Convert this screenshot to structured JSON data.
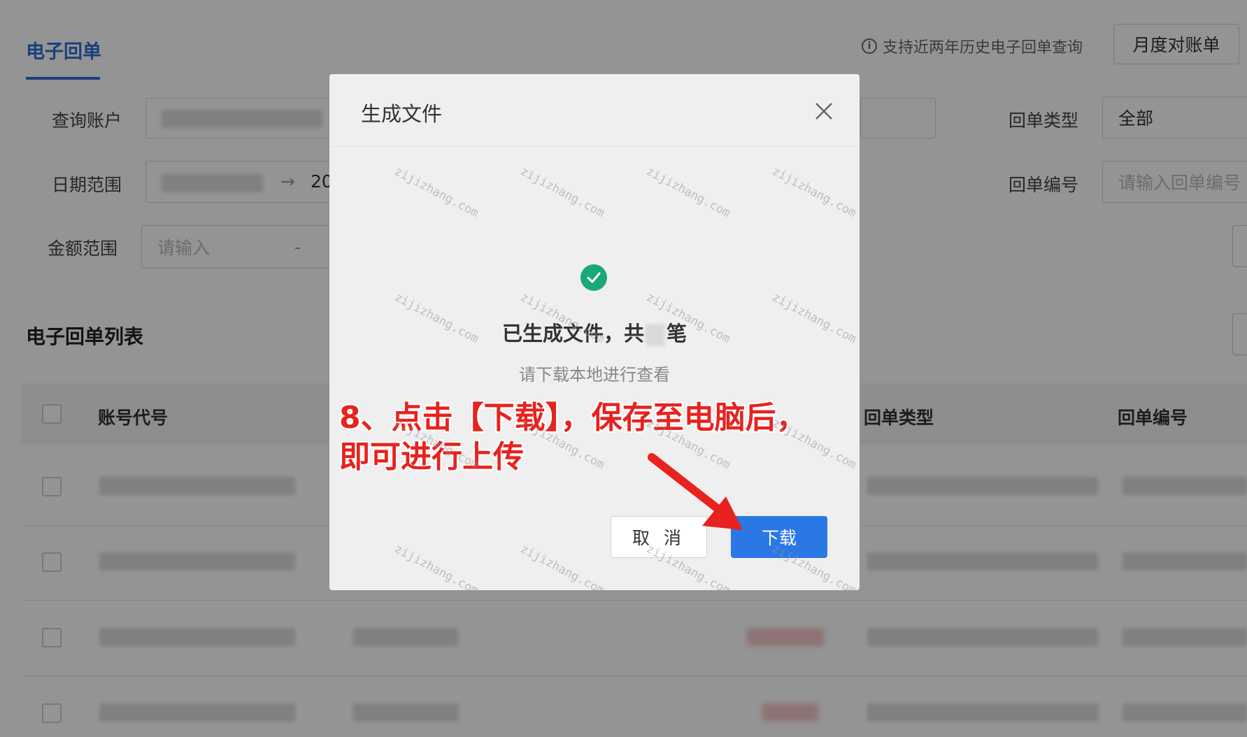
{
  "page": {
    "tab_label": "电子回单",
    "notice_text": "支持近两年历史电子回单查询",
    "monthly_button": "月度对账单",
    "filters": {
      "account_label": "查询账户",
      "date_label": "日期范围",
      "date_separator": "→",
      "date_end_prefix": "20",
      "amount_label": "金额范围",
      "amount_placeholder": "请输入",
      "amount_separator": "-",
      "type_label": "回单类型",
      "type_value": "全部",
      "number_label": "回单编号",
      "number_placeholder": "请输入回单编号"
    },
    "list_title": "电子回单列表",
    "columns": [
      "账号代号",
      "回单类型",
      "回单编号"
    ]
  },
  "modal": {
    "title": "生成文件",
    "message_prefix": "已生成文件，共",
    "message_suffix": "笔",
    "sub_message": "请下载本地进行查看",
    "cancel_label": "取 消",
    "download_label": "下载"
  },
  "annotation": {
    "line1": "8、点击【下载】，保存至电脑后，",
    "line2": "即可进行上传",
    "color": "#e8221e"
  },
  "watermark_text": "zijizhang.com",
  "colors": {
    "accent": "#2d6fd6",
    "primary_button": "#2b78e4",
    "success": "#1aa876"
  }
}
